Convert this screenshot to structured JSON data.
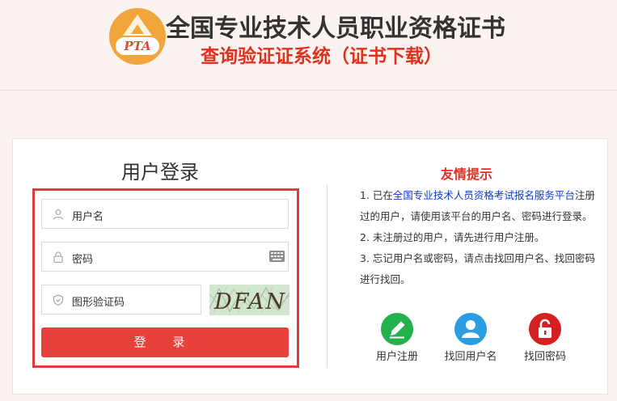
{
  "header": {
    "logo_text": "PTA",
    "title": "全国专业技术人员职业资格证书",
    "subtitle": "查询验证证系统（证书下载）"
  },
  "login": {
    "title": "用户登录",
    "username_placeholder": "用户名",
    "password_placeholder": "密码",
    "captcha_placeholder": "图形验证码",
    "captcha_text": "DFAN",
    "submit_label": "登  录"
  },
  "tips": {
    "title": "友情提示",
    "item1_prefix": "1. 已在",
    "item1_link": "全国专业技术人员资格考试报名服务平台",
    "item1_suffix": "注册过的用户，请使用该平台的用户名、密码进行登录。",
    "item2": "2. 未注册过的用户，请先进行用户注册。",
    "item3": "3. 忘记用户名或密码，请点击找回用户名、找回密码进行找回。"
  },
  "actions": [
    {
      "label": "用户注册",
      "icon": "pencil-icon",
      "color": "#22b14c"
    },
    {
      "label": "找回用户名",
      "icon": "user-icon",
      "color": "#2a9ee0"
    },
    {
      "label": "找回密码",
      "icon": "lock-icon",
      "color": "#d42020"
    }
  ]
}
